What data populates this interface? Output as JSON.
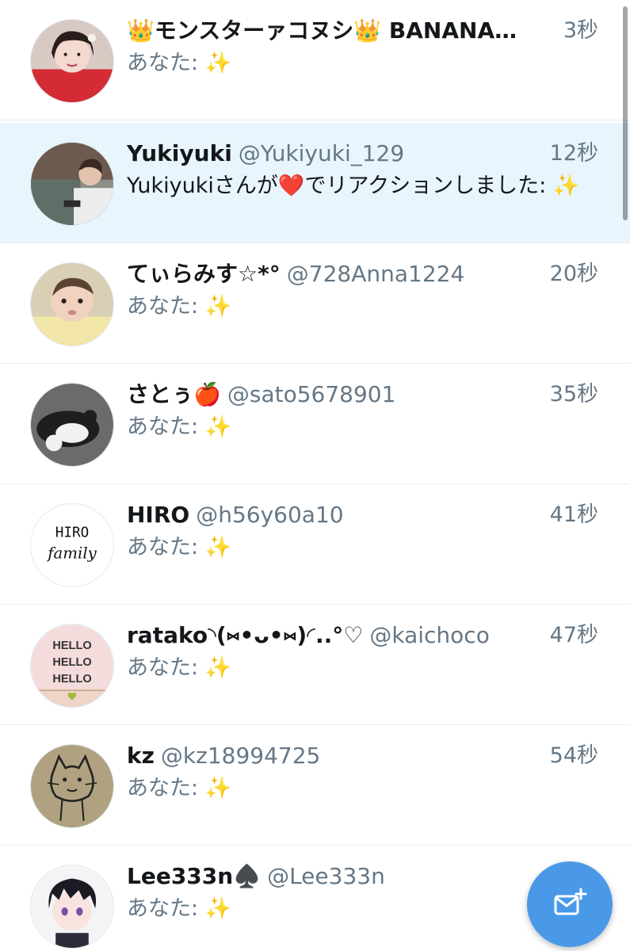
{
  "colors": {
    "accent": "#4a99e9",
    "highlight_row": "#e8f5fd",
    "muted_text": "#657786"
  },
  "conversations": [
    {
      "name": "👑モンスターァコヌシ👑 BANANA…",
      "handle": "",
      "time": "3秒",
      "message": "あなた: ✨",
      "avatar": "avatar-girl-photo"
    },
    {
      "name": "Yukiyuki",
      "handle": "@Yukiyuki_129",
      "time": "12秒",
      "message": "Yukiyukiさんが❤️でリアクションしました: ✨",
      "avatar": "avatar-boy-photo"
    },
    {
      "name": "てぃらみす☆*°",
      "handle": "@728Anna1224",
      "time": "20秒",
      "message": "あなた: ✨",
      "avatar": "avatar-baby-photo"
    },
    {
      "name": "さとぅ🍎",
      "handle": "@sato5678901",
      "time": "35秒",
      "message": "あなた: ✨",
      "avatar": "avatar-cat-photo"
    },
    {
      "name": "HIRO",
      "handle": "@h56y60a10",
      "time": "41秒",
      "message": "あなた: ✨",
      "avatar": "avatar-hiro-family-text",
      "avatar_text": [
        "HIRO",
        "family"
      ]
    },
    {
      "name": "ratako◝(⑅•ᴗ•⑅)◜..°♡",
      "handle": "@kaichoco",
      "time": "47秒",
      "message": "あなた: ✨",
      "avatar": "avatar-hello-text",
      "avatar_text": [
        "HELLO",
        "HELLO",
        "HELLO"
      ]
    },
    {
      "name": "kz",
      "handle": "@kz18994725",
      "time": "54秒",
      "message": "あなた: ✨",
      "avatar": "avatar-cat-drawing"
    },
    {
      "name": "Lee333n♠️",
      "handle": "@Lee333n",
      "time": "",
      "message": "あなた: ✨",
      "avatar": "avatar-anime-character"
    }
  ],
  "fab": {
    "icon": "new-message-icon"
  }
}
